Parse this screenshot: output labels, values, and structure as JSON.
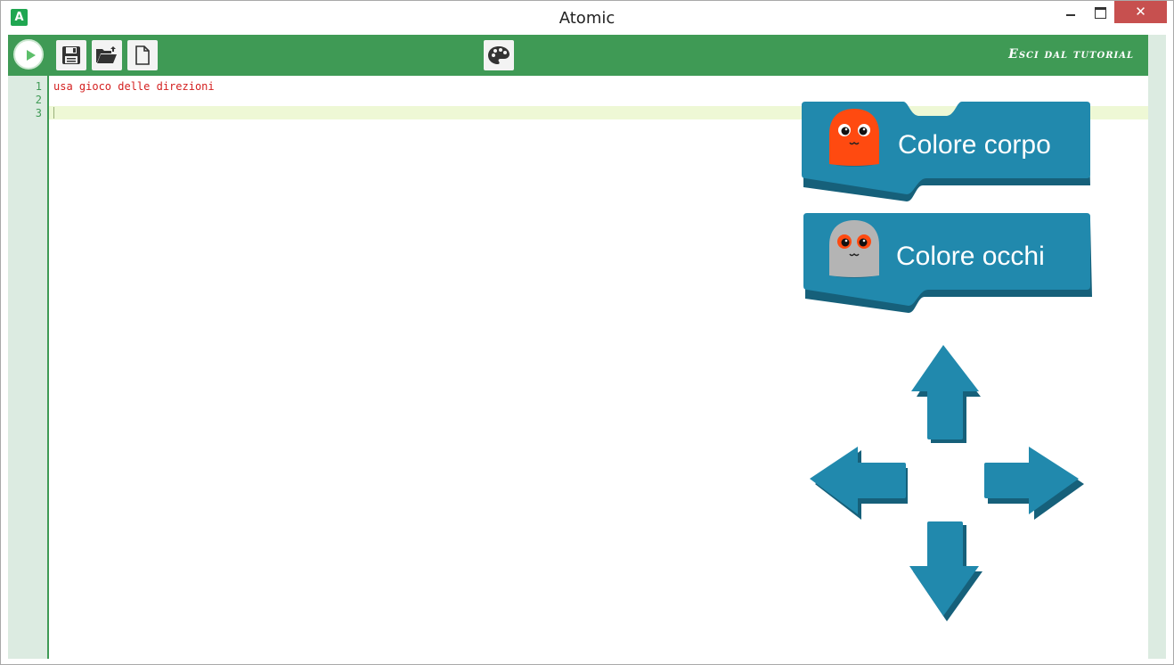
{
  "window": {
    "title": "Atomic",
    "app_icon_letter": "A",
    "close_glyph": "✕"
  },
  "toolbar": {
    "exit_tutorial_label": "Esci dal tutorial",
    "accent_color": "#3f9a55",
    "icons": [
      "play-icon",
      "save-icon",
      "open-folder-icon",
      "new-file-icon",
      "palette-icon"
    ]
  },
  "editor": {
    "line_numbers": [
      "1",
      "2",
      "3"
    ],
    "lines": [
      "usa gioco delle direzioni",
      "",
      ""
    ],
    "code_color": "#d42020"
  },
  "blocks": {
    "body_color": {
      "label": "Colore corpo",
      "character_color": "#ff4a10"
    },
    "eye_color": {
      "label": "Colore occhi",
      "character_color": "#b4b4b4"
    },
    "block_color": "#2189ad"
  },
  "arrows": [
    "arrow-up-icon",
    "arrow-left-icon",
    "arrow-right-icon",
    "arrow-down-icon"
  ]
}
